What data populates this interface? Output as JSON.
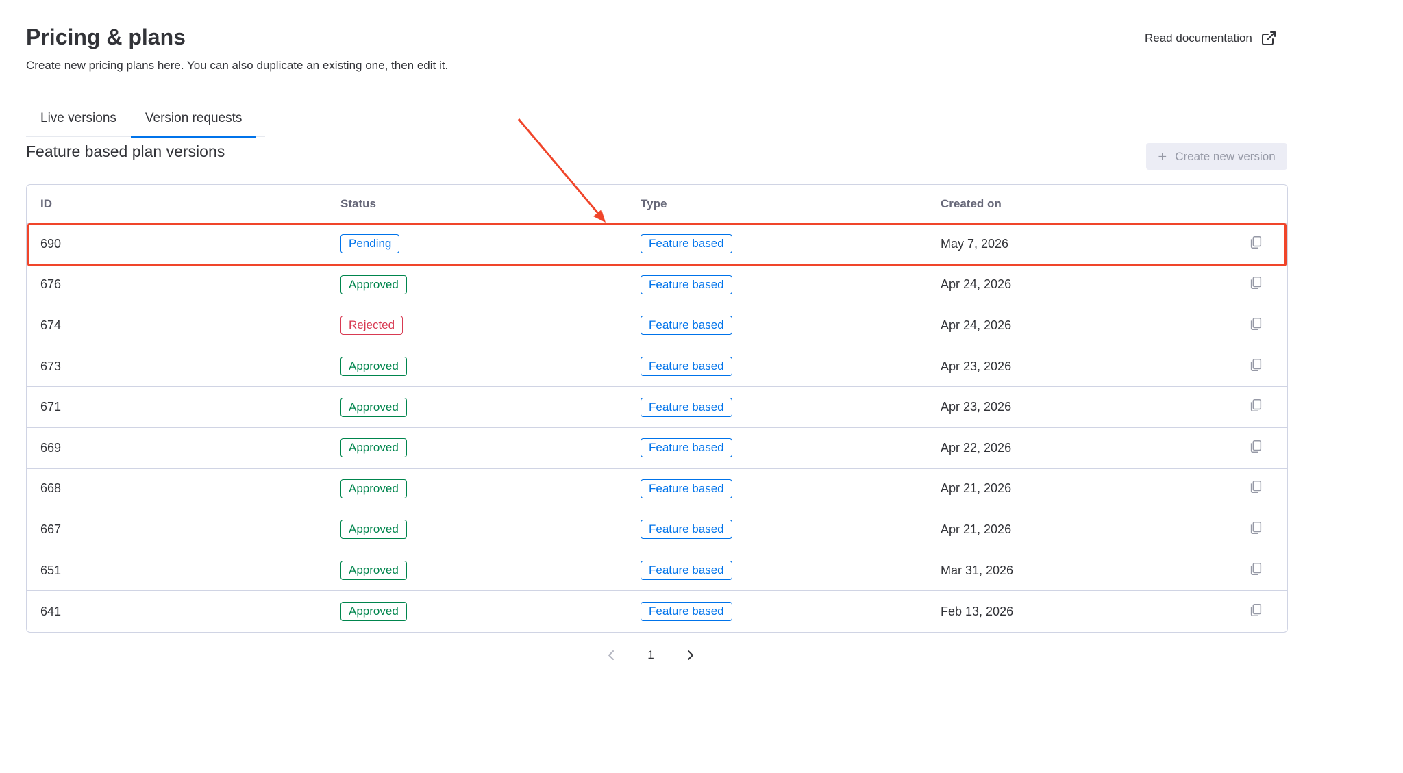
{
  "header": {
    "title": "Pricing & plans",
    "subtitle": "Create new pricing plans here. You can also duplicate an existing one, then edit it.",
    "doc_link_label": "Read documentation"
  },
  "tabs": [
    {
      "label": "Live versions",
      "active": false
    },
    {
      "label": "Version requests",
      "active": true
    }
  ],
  "section": {
    "title": "Feature based plan versions",
    "create_button_label": "Create new version"
  },
  "table": {
    "columns": [
      "ID",
      "Status",
      "Type",
      "Created on"
    ],
    "rows": [
      {
        "id": "690",
        "status": "Pending",
        "type": "Feature based",
        "created": "May 7, 2026"
      },
      {
        "id": "676",
        "status": "Approved",
        "type": "Feature based",
        "created": "Apr 24, 2026"
      },
      {
        "id": "674",
        "status": "Rejected",
        "type": "Feature based",
        "created": "Apr 24, 2026"
      },
      {
        "id": "673",
        "status": "Approved",
        "type": "Feature based",
        "created": "Apr 23, 2026"
      },
      {
        "id": "671",
        "status": "Approved",
        "type": "Feature based",
        "created": "Apr 23, 2026"
      },
      {
        "id": "669",
        "status": "Approved",
        "type": "Feature based",
        "created": "Apr 22, 2026"
      },
      {
        "id": "668",
        "status": "Approved",
        "type": "Feature based",
        "created": "Apr 21, 2026"
      },
      {
        "id": "667",
        "status": "Approved",
        "type": "Feature based",
        "created": "Apr 21, 2026"
      },
      {
        "id": "651",
        "status": "Approved",
        "type": "Feature based",
        "created": "Mar 31, 2026"
      },
      {
        "id": "641",
        "status": "Approved",
        "type": "Feature based",
        "created": "Feb 13, 2026"
      }
    ]
  },
  "pagination": {
    "current_page": "1"
  },
  "colors": {
    "pending": "#0073ea",
    "approved": "#00854d",
    "rejected": "#d83a52",
    "type": "#0073ea",
    "highlight": "#f0452a"
  },
  "icons": {
    "doc_link": "external-link-icon",
    "copy": "copy-icon",
    "plus": "plus-icon",
    "prev": "chevron-left-icon",
    "next": "chevron-right-icon"
  }
}
